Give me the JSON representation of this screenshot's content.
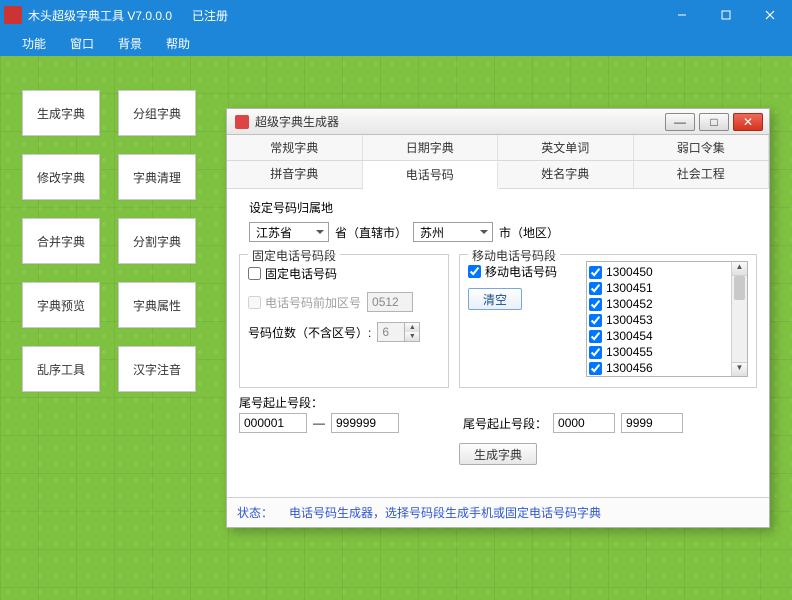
{
  "titlebar": {
    "title": "木头超级字典工具 V7.0.0.0",
    "registered": "已注册"
  },
  "menubar": {
    "items": [
      "功能",
      "窗口",
      "背景",
      "帮助"
    ]
  },
  "side_buttons": [
    "生成字典",
    "分组字典",
    "修改字典",
    "字典清理",
    "合并字典",
    "分割字典",
    "字典预览",
    "字典属性",
    "乱序工具",
    "汉字注音"
  ],
  "child": {
    "title": "超级字典生成器",
    "tabs_row1": [
      "常规字典",
      "日期字典",
      "英文单词",
      "弱口令集"
    ],
    "tabs_row2": [
      "拼音字典",
      "电话号码",
      "姓名字典",
      "社会工程"
    ],
    "active_tab": "电话号码"
  },
  "locality": {
    "label": "设定号码归属地",
    "province": "江苏省",
    "province_suffix": "省（直辖市）",
    "city": "苏州",
    "city_suffix": "市（地区）"
  },
  "fixed_group": {
    "legend": "固定电话号码段",
    "chk_fixed": "固定电话号码",
    "chk_areacode": "电话号码前加区号",
    "areacode": "0512",
    "digits_label": "号码位数（不含区号）:",
    "digits": "6"
  },
  "mobile_group": {
    "legend": "移动电话号码段",
    "chk_mobile": "移动电话号码",
    "clear_btn": "清空",
    "items": [
      "1300450",
      "1300451",
      "1300452",
      "1300453",
      "1300454",
      "1300455",
      "1300456"
    ]
  },
  "tail": {
    "fixed_label": "尾号起止号段：",
    "fixed_from": "000001",
    "fixed_sep": "—",
    "fixed_to": "999999",
    "mobile_label": "尾号起止号段：",
    "mobile_from": "0000",
    "mobile_to": "9999"
  },
  "generate_btn": "生成字典",
  "status": {
    "key": "状态：",
    "msg": "电话号码生成器，选择号码段生成手机或固定电话号码字典"
  }
}
